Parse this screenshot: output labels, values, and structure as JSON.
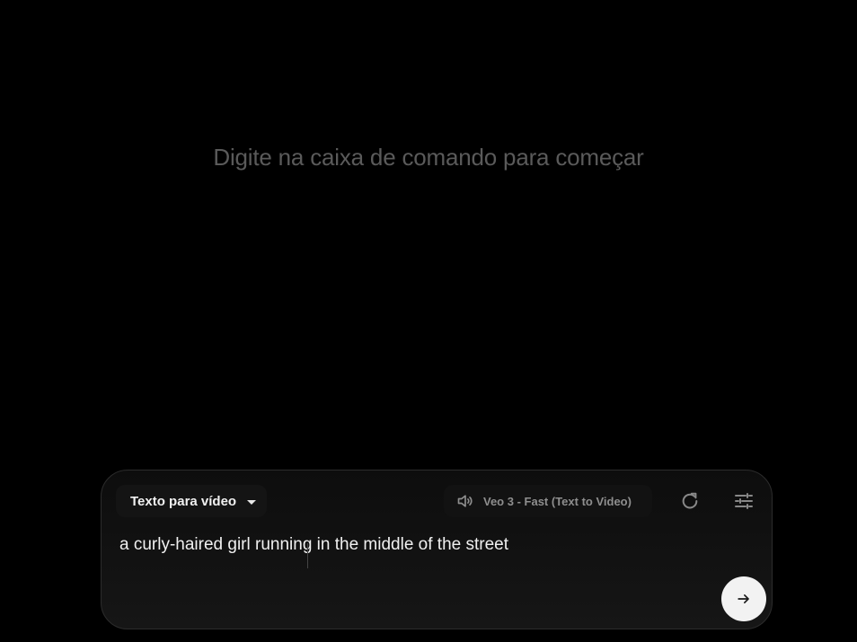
{
  "empty_state": {
    "hint": "Digite na caixa de comando para começar"
  },
  "composer": {
    "mode_label": "Texto para vídeo",
    "model_label": "Veo 3 - Fast (Text to Video)",
    "prompt_value": "a curly-haired girl running in the middle of the street",
    "icons": {
      "mode_caret": "caret-down-icon",
      "model_audio": "speaker-icon",
      "refresh": "refresh-icon",
      "settings": "tune-sliders-icon",
      "send": "arrow-right-icon"
    }
  },
  "colors": {
    "background": "#000000",
    "panel": "#141414",
    "text": "#f0f0f0",
    "muted": "#5a5a5a",
    "send_button": "#f2f2f2"
  }
}
